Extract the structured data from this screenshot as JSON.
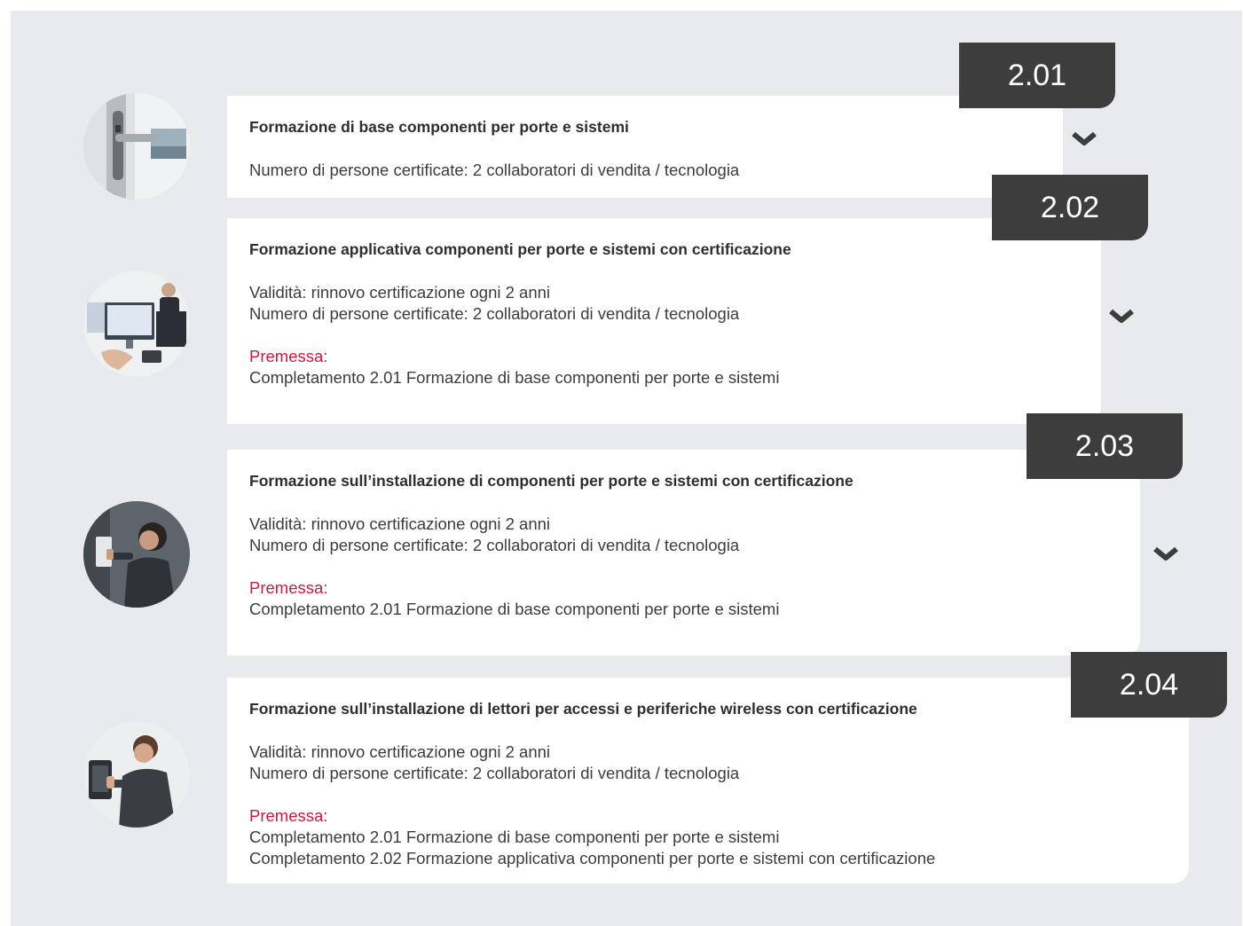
{
  "courses": [
    {
      "number": "2.01",
      "title": "Formazione di base componenti per porte e sistemi",
      "validity": "",
      "people": "Numero di persone certificate: 2 collaboratori di vendita / tecnologia",
      "premise_label": "",
      "premises": []
    },
    {
      "number": "2.02",
      "title": "Formazione applicativa componenti per porte e sistemi con certificazione",
      "validity": "Validità: rinnovo certificazione ogni 2 anni",
      "people": "Numero di persone certificate: 2 collaboratori di vendita / tecnologia",
      "premise_label": "Premessa:",
      "premises": [
        "Completamento 2.01 Formazione di base componenti per porte e sistemi"
      ]
    },
    {
      "number": "2.03",
      "title": "Formazione sull’installazione di componenti per porte e sistemi con certificazione",
      "validity": "Validità: rinnovo certificazione ogni 2 anni",
      "people": "Numero di persone certificate: 2 collaboratori di vendita / tecnologia",
      "premise_label": "Premessa:",
      "premises": [
        "Completamento 2.01 Formazione di base componenti per porte e sistemi"
      ]
    },
    {
      "number": "2.04",
      "title": "Formazione sull’installazione di lettori per accessi e periferiche wireless con certificazione",
      "validity": "Validità: rinnovo certificazione ogni 2 anni",
      "people": "Numero di persone certificate: 2 collaboratori di vendita / tecnologia",
      "premise_label": "Premessa:",
      "premises": [
        "Completamento 2.01 Formazione di base componenti per porte e sistemi",
        "Completamento 2.02 Formazione applicativa componenti per porte e sistemi con certificazione"
      ]
    }
  ],
  "colors": {
    "background": "#e9eaed",
    "badge": "#3d3d3d",
    "premise_accent": "#d0173b",
    "chevron": "#3d3d3d"
  },
  "icons": {
    "expand": "chevron-down-icon"
  }
}
